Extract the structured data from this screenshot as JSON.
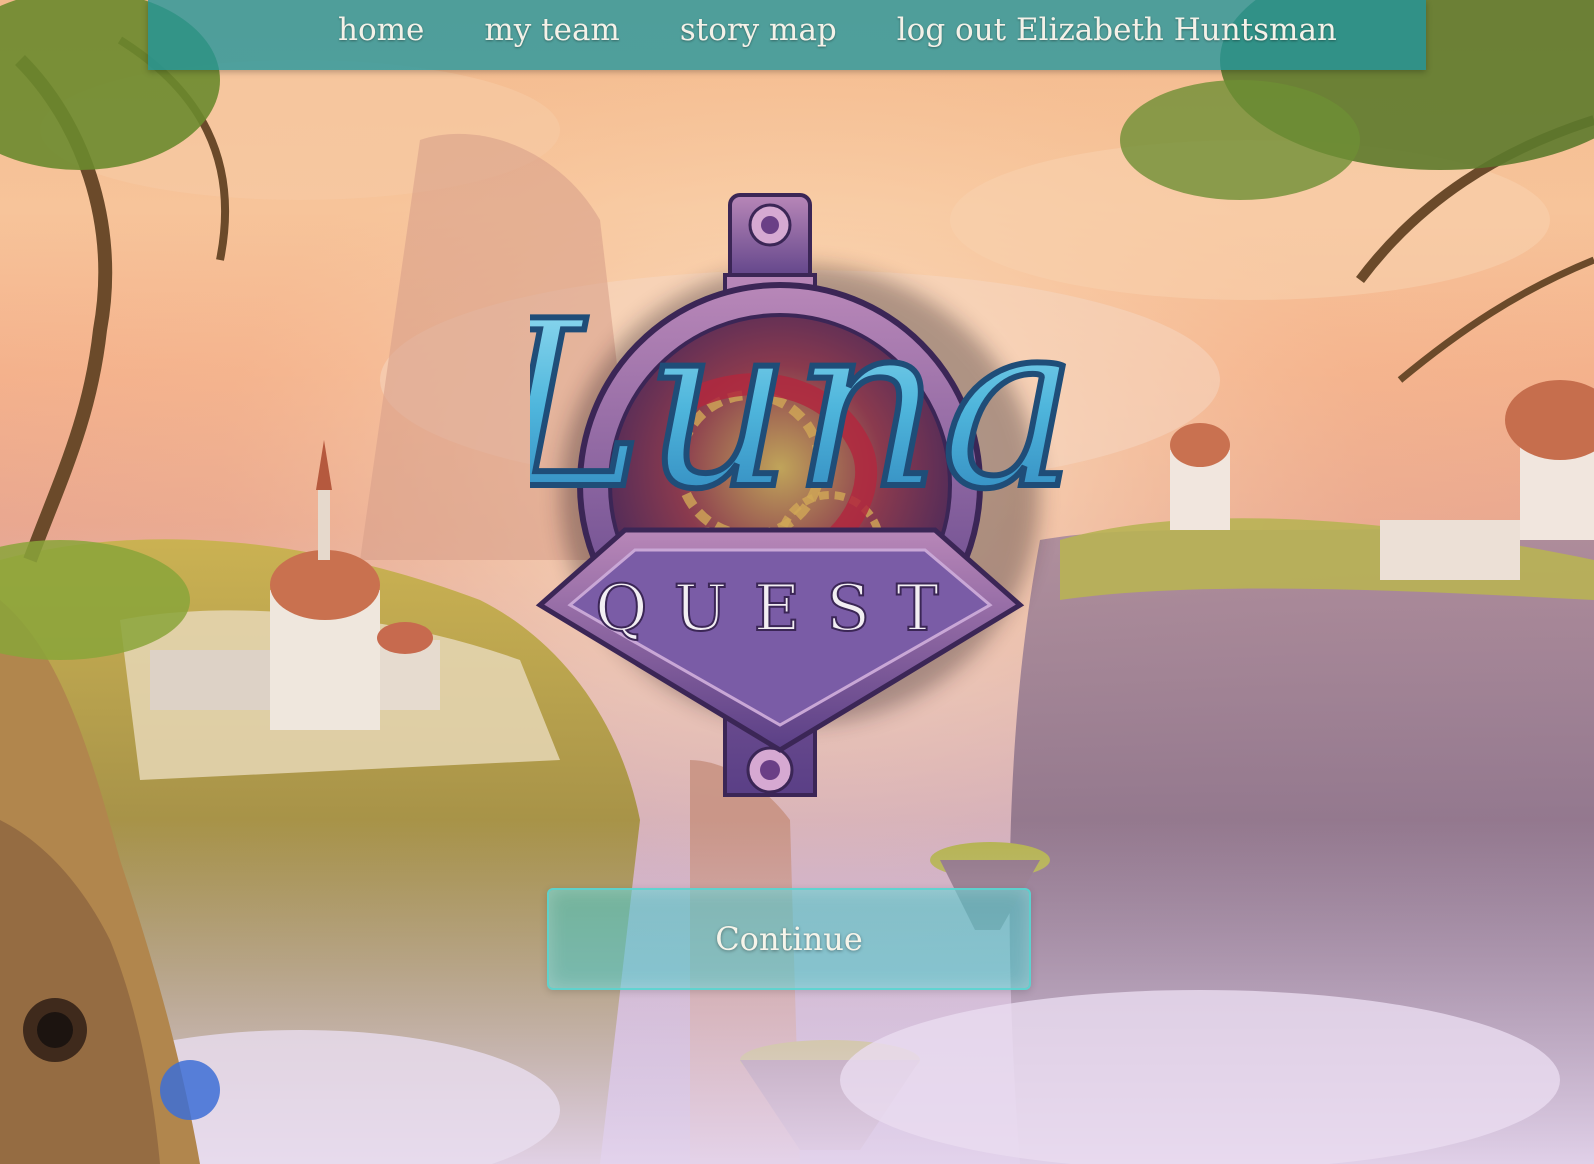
{
  "nav": {
    "items": [
      {
        "label": "home"
      },
      {
        "label": "my team"
      },
      {
        "label": "story map"
      },
      {
        "label": "log out Elizabeth Huntsman"
      }
    ]
  },
  "logo": {
    "title": "Luna",
    "subtitle": "QUEST"
  },
  "actions": {
    "continue_label": "Continue"
  },
  "colors": {
    "nav_bg": "#20969e",
    "button_bg": "#46c8c8",
    "logo_text": "#4fb6dc"
  }
}
